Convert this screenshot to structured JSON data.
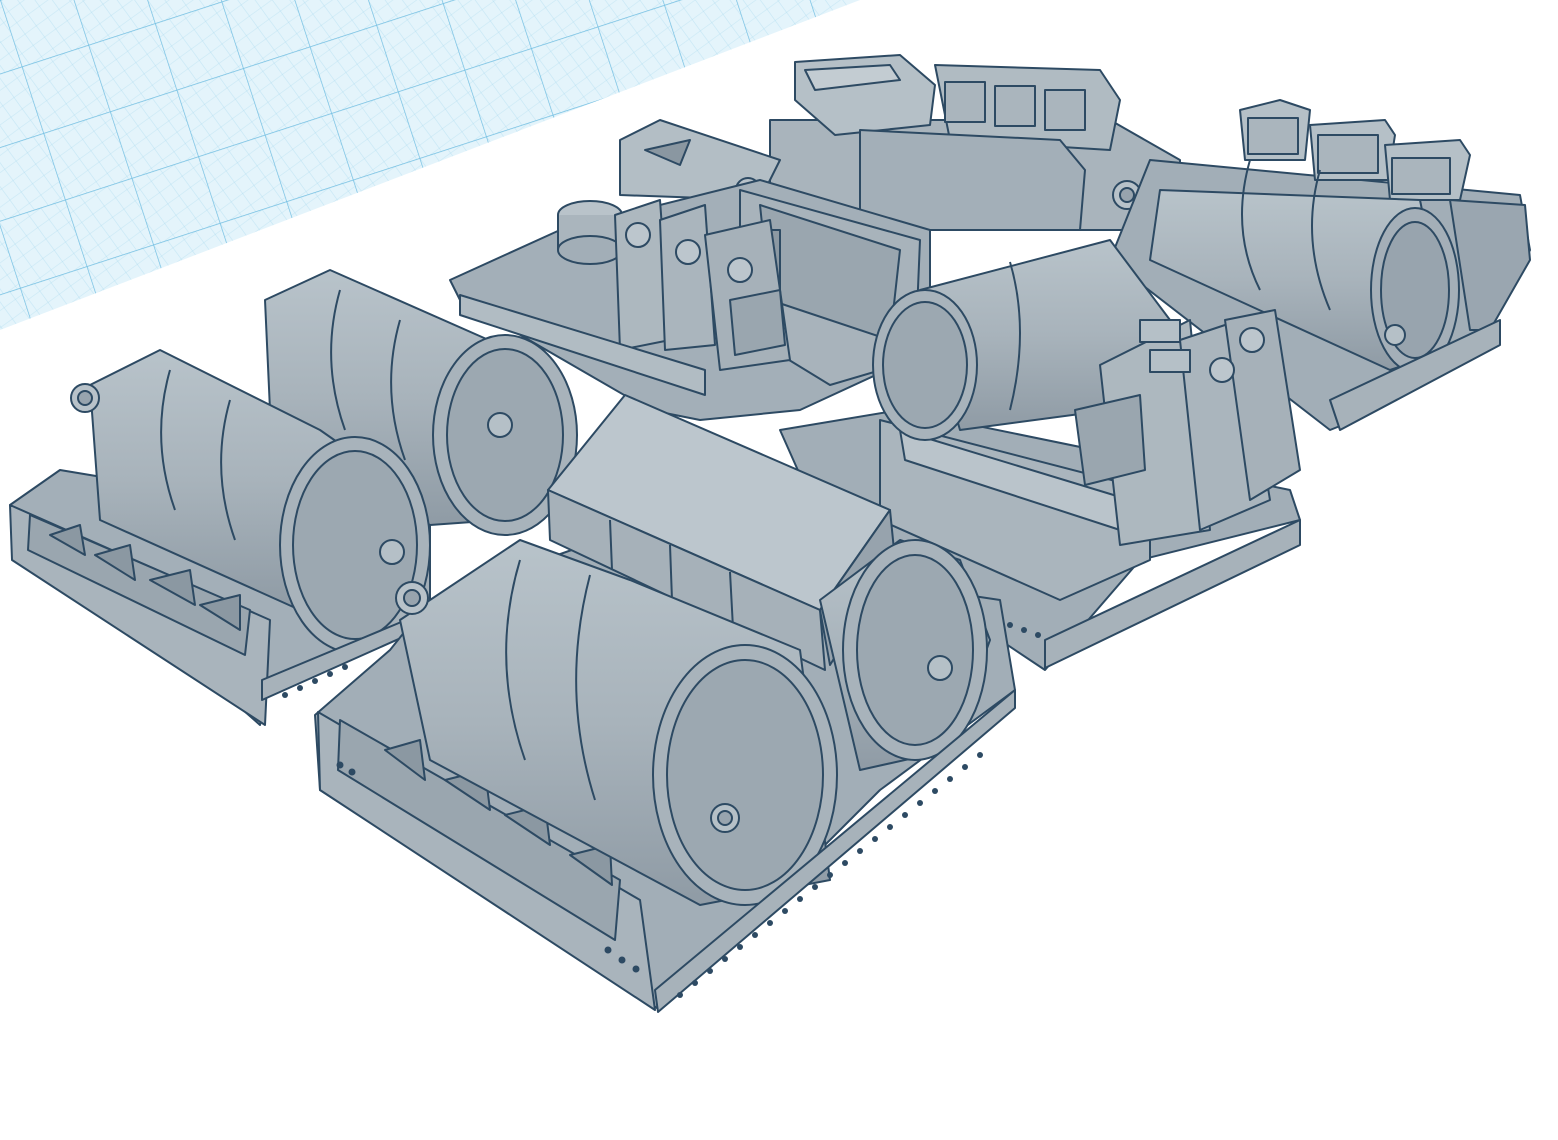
{
  "workspace": {
    "background": "#ffffff",
    "grid_color": "#7ec6e4",
    "grid_fill": "#dff2fb",
    "model_fill": "#a6b2bb",
    "model_light": "#bcc6cd",
    "model_dark": "#8995a0",
    "edge_color": "#2d4a63"
  },
  "scene": {
    "objects": [
      {
        "name": "front-left-barrel-pallet",
        "type": "barrel-pallet",
        "barrels": 2
      },
      {
        "name": "front-center-barrel-pallet",
        "type": "barrel-pallet",
        "barrels": 2,
        "crates": 1
      },
      {
        "name": "center-crate-pallet",
        "type": "crate-pallet",
        "jerrycans": 3,
        "spool": 1
      },
      {
        "name": "right-barrel-pallet",
        "type": "barrel-pallet",
        "barrels": 1,
        "jerrycans": 3
      },
      {
        "name": "back-right-barrel-pallet",
        "type": "barrel-pallet",
        "barrels": 1,
        "vents": 3
      },
      {
        "name": "back-center-crate-pallet",
        "type": "crate-pallet",
        "crates": 2
      }
    ]
  }
}
